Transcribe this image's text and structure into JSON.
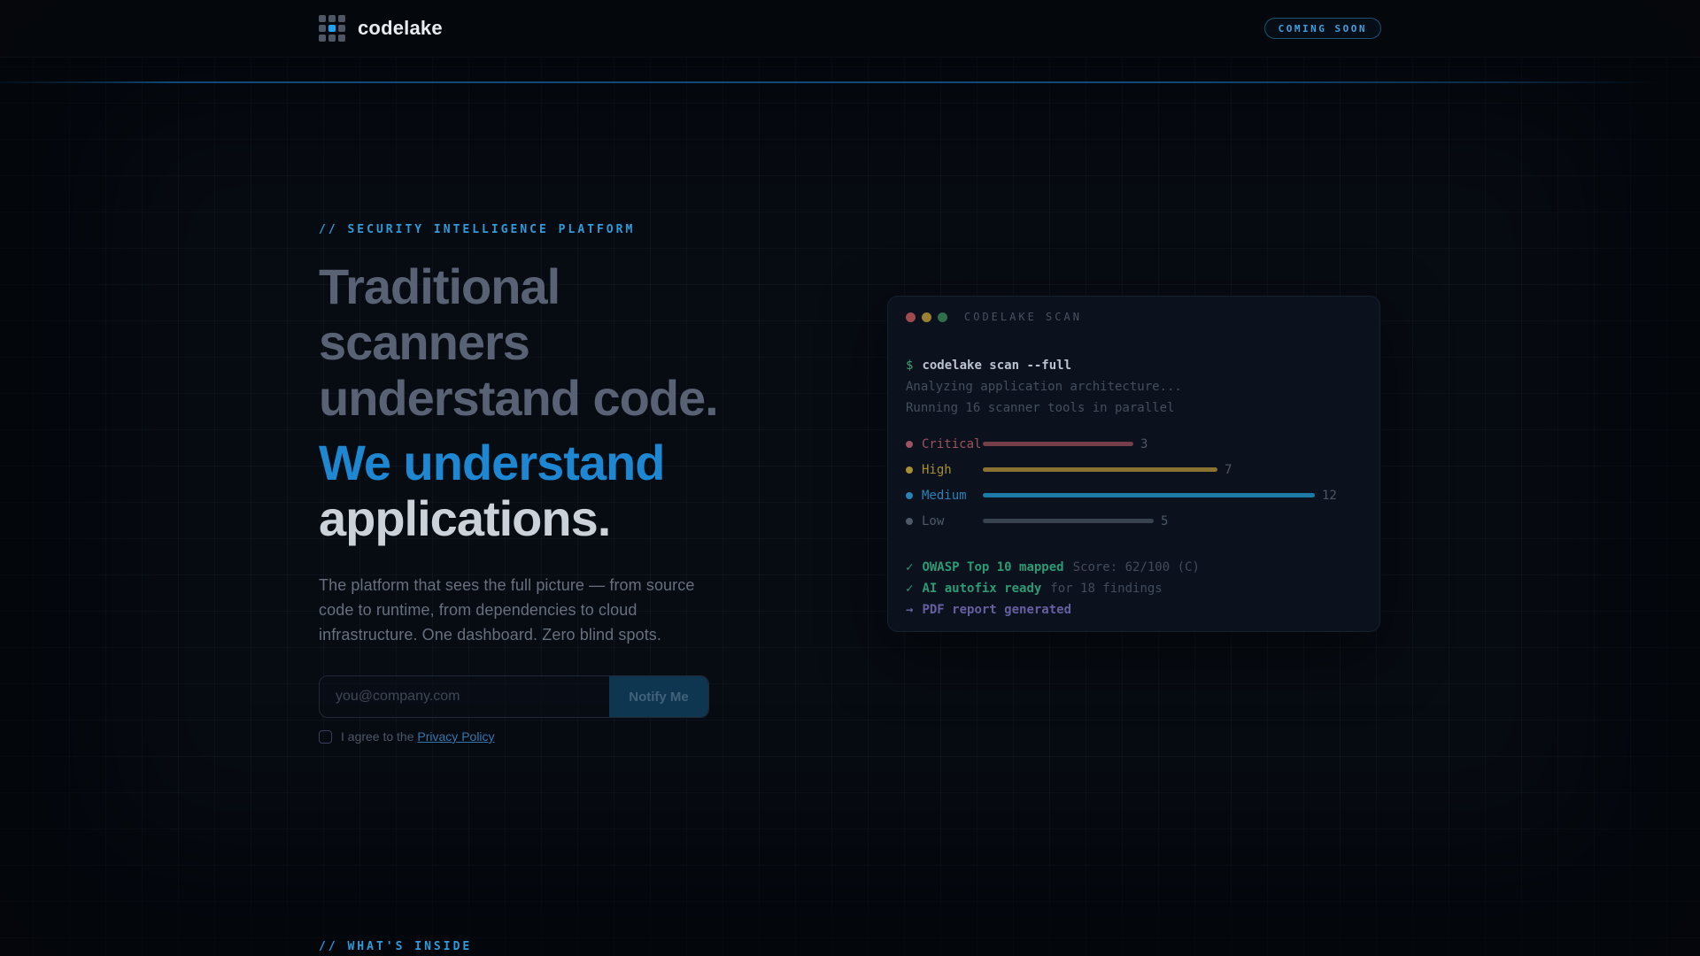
{
  "brand": {
    "name": "codelake"
  },
  "header": {
    "badge": "COMING SOON"
  },
  "hero": {
    "eyebrow": "// SECURITY INTELLIGENCE PLATFORM",
    "headline_muted_line1": "Traditional scanners",
    "headline_muted_line2": "understand code.",
    "headline_accent": "We understand",
    "headline_strong": "applications.",
    "paragraph": "The platform that sees the full picture — from source code to runtime, from dependencies to cloud infrastructure. One dashboard. Zero blind spots.",
    "form": {
      "email_placeholder": "you@company.com",
      "submit_label": "Notify Me",
      "consent_text": "I agree to the",
      "consent_link": "Privacy Policy"
    }
  },
  "terminal": {
    "title": "CODELAKE SCAN",
    "prompt": "$",
    "command": "codelake scan --full",
    "output_lines": [
      "Analyzing application architecture...",
      "Running 16 scanner tools in parallel"
    ],
    "chart_data": {
      "type": "bar",
      "categories": [
        "Critical",
        "High",
        "Medium",
        "Low"
      ],
      "values": [
        3,
        7,
        12,
        5
      ]
    },
    "bars": [
      {
        "label": "Critical",
        "value": "3",
        "label_style": "color:#9c545e",
        "dot_style": "background:#9c545e",
        "bar_style": "width:170px;background:#743f49"
      },
      {
        "label": "High",
        "value": "7",
        "label_style": "color:#a98f33",
        "dot_style": "background:#a98f33",
        "bar_style": "width:265px;background:#8a7230"
      },
      {
        "label": "Medium",
        "value": "12",
        "label_style": "color:#2a82b4",
        "dot_style": "background:#2a82b4",
        "bar_style": "width:375px;background:#1d7aa8"
      },
      {
        "label": "Low",
        "value": "5",
        "label_style": "color:#4e5a68",
        "dot_style": "background:#4e5a68",
        "bar_style": "width:193px;background:#39424f"
      }
    ],
    "summary": [
      {
        "icon": "✓",
        "text": "OWASP Top 10 mapped",
        "suffix": "Score: 62/100 (C)",
        "main_style": "color:#2d9a74"
      },
      {
        "icon": "✓",
        "text": "AI autofix ready",
        "suffix": "for 18 findings",
        "main_style": "color:#2d9a74"
      },
      {
        "icon": "→",
        "text": "PDF report generated",
        "suffix": "",
        "main_style": "color:#675fa0"
      }
    ]
  },
  "footer": {
    "label": "// WHAT'S INSIDE"
  },
  "colors": {
    "page_background": "#070b12",
    "accent_blue": "#1d87d1",
    "eyebrow_blue": "#2f9bd9",
    "badge_blue": "#3ea0da",
    "logo_accent": "#1ba4f0",
    "headline_muted": "#596274",
    "headline_strong": "#ccd2da",
    "critical": "#9c545e",
    "high": "#a98f33",
    "medium": "#2a82b4",
    "low": "#4e5a68",
    "success_green": "#2d9a74",
    "report_purple": "#675fa0"
  }
}
